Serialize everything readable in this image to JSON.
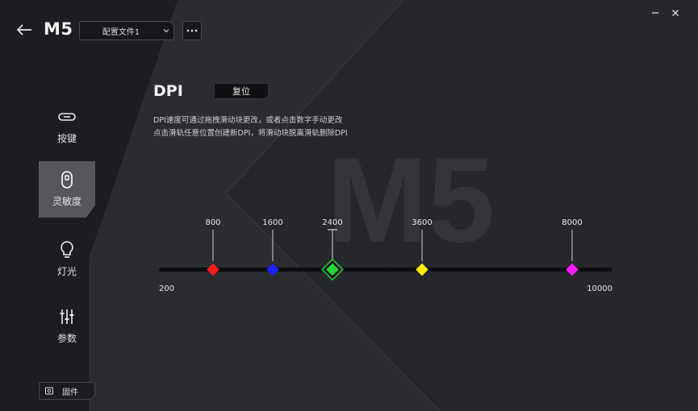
{
  "header": {
    "model": "M5",
    "profile_label": "配置文件1",
    "more_label": "···"
  },
  "sidebar": {
    "items": [
      {
        "label": "按键",
        "icon": "button-icon"
      },
      {
        "label": "灵敏度",
        "icon": "mouse-icon",
        "active": true
      },
      {
        "label": "灯光",
        "icon": "lightbulb-icon"
      },
      {
        "label": "参数",
        "icon": "sliders-icon"
      }
    ],
    "firmware_label": "固件"
  },
  "main": {
    "title": "DPI",
    "reset_label": "复位",
    "desc_line1": "DPI速度可通过拖拽滑动块更改，或者点击数字手动更改",
    "desc_line2": "点击滑轨任意位置创建新DPI，将滑动块脱离滑轨删除DPI"
  },
  "background": {
    "watermark": "M5"
  },
  "dpi_slider": {
    "min": 200,
    "max": 10000,
    "min_label": "200",
    "max_label": "10000",
    "stages": [
      {
        "value": 800,
        "label": "800",
        "color": "#ff1a1a",
        "selected": false
      },
      {
        "value": 1600,
        "label": "1600",
        "color": "#1f1fff",
        "selected": false
      },
      {
        "value": 2400,
        "label": "2400",
        "color": "#22d633",
        "selected": true
      },
      {
        "value": 3600,
        "label": "3600",
        "color": "#ffee00",
        "selected": false
      },
      {
        "value": 8000,
        "label": "8000",
        "color": "#ff1aff",
        "selected": false
      }
    ]
  },
  "colors": {
    "background": "#202124",
    "panel": "#2a2b2f",
    "accent_selected": "#22d633"
  }
}
